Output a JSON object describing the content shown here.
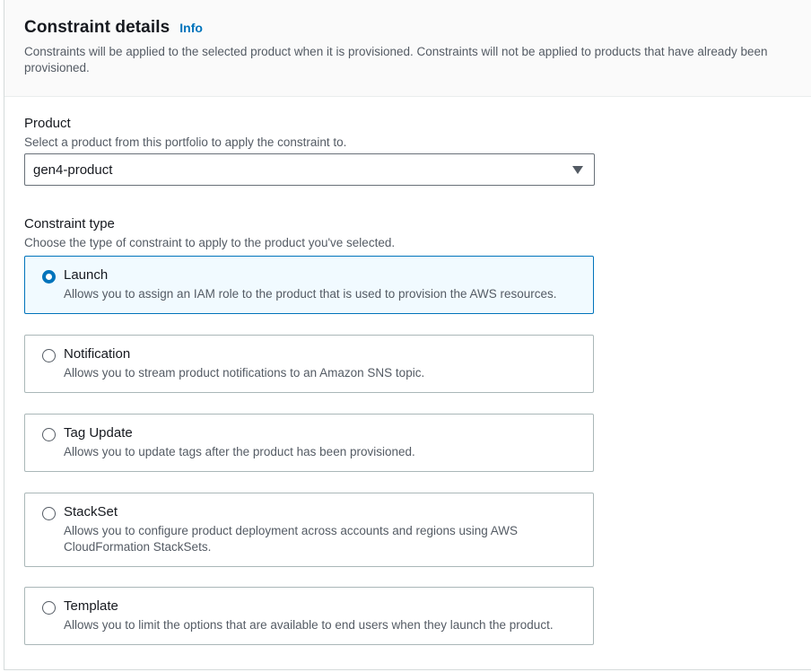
{
  "header": {
    "title": "Constraint details",
    "info_link": "Info",
    "description": "Constraints will be applied to the selected product when it is provisioned. Constraints will not be applied to products that have already been provisioned."
  },
  "product": {
    "label": "Product",
    "description": "Select a product from this portfolio to apply the constraint to.",
    "selected_value": "gen4-product"
  },
  "constraint_type": {
    "label": "Constraint type",
    "description": "Choose the type of constraint to apply to the product you've selected.",
    "options": [
      {
        "label": "Launch",
        "description": "Allows you to assign an IAM role to the product that is used to provision the AWS resources.",
        "selected": true
      },
      {
        "label": "Notification",
        "description": "Allows you to stream product notifications to an Amazon SNS topic.",
        "selected": false
      },
      {
        "label": "Tag Update",
        "description": "Allows you to update tags after the product has been provisioned.",
        "selected": false
      },
      {
        "label": "StackSet",
        "description": "Allows you to configure product deployment across accounts and regions using AWS CloudFormation StackSets.",
        "selected": false
      },
      {
        "label": "Template",
        "description": "Allows you to limit the options that are available to end users when they launch the product.",
        "selected": false
      }
    ]
  },
  "colors": {
    "accent": "#0073bb",
    "selected_bg": "#f1faff",
    "border": "#aab7b8",
    "secondary_text": "#545b64"
  }
}
